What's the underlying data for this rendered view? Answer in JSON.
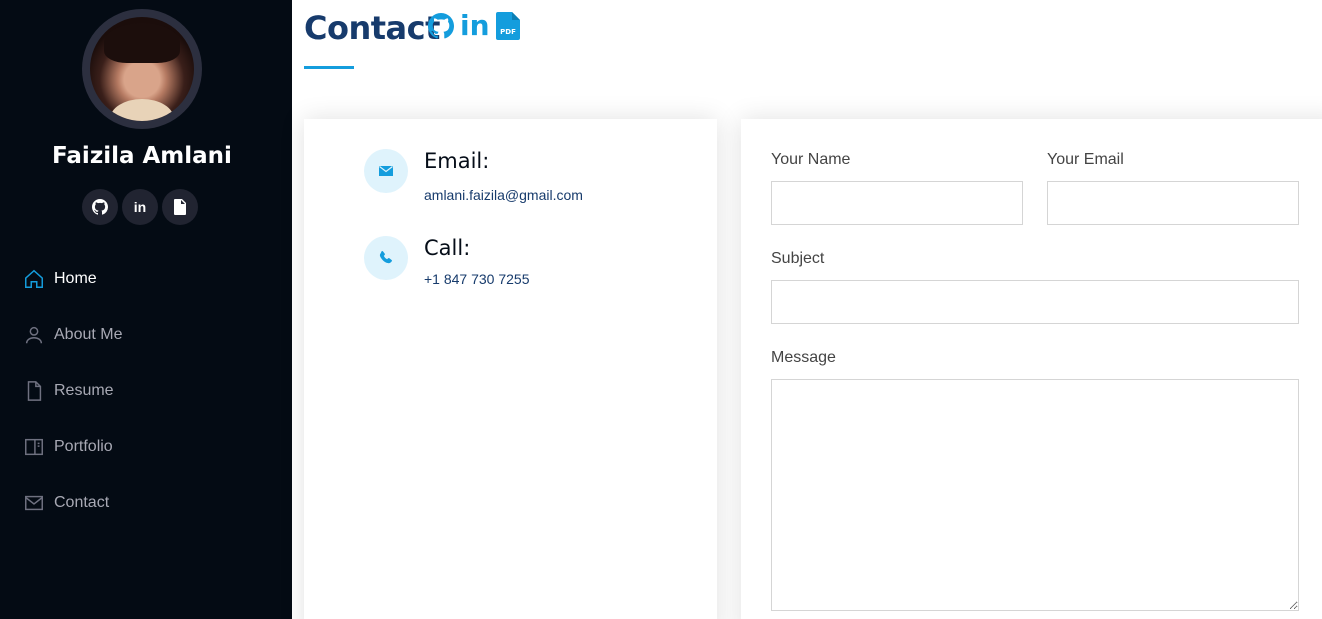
{
  "profile": {
    "name": "Faizila Amlani",
    "socials": [
      {
        "icon": "github-icon"
      },
      {
        "icon": "linkedin-icon",
        "label": "in"
      },
      {
        "icon": "pdf-icon"
      }
    ]
  },
  "nav": {
    "items": [
      {
        "label": "Home",
        "icon": "home-icon",
        "active": true
      },
      {
        "label": "About Me",
        "icon": "person-icon",
        "active": false
      },
      {
        "label": "Resume",
        "icon": "file-icon",
        "active": false
      },
      {
        "label": "Portfolio",
        "icon": "book-icon",
        "active": false
      },
      {
        "label": "Contact",
        "icon": "envelope-icon",
        "active": false
      }
    ]
  },
  "page": {
    "title": "Contact",
    "title_icons": [
      "github-icon",
      "linkedin-icon",
      "pdf-icon"
    ],
    "linkedin_text": "in"
  },
  "contact_info": {
    "email": {
      "heading": "Email:",
      "value": "amlani.faizila@gmail.com"
    },
    "call": {
      "heading": "Call:",
      "value": "+1 847 730 7255"
    }
  },
  "form": {
    "name_label": "Your Name",
    "name_value": "",
    "email_label": "Your Email",
    "email_value": "",
    "subject_label": "Subject",
    "subject_value": "",
    "message_label": "Message",
    "message_value": ""
  },
  "colors": {
    "sidebar_bg": "#040b14",
    "accent": "#149ddd",
    "heading": "#173b6c"
  }
}
